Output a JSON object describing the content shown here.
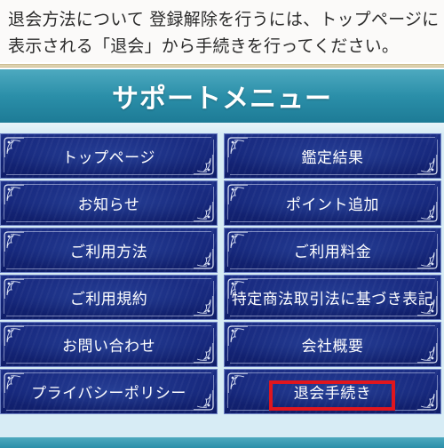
{
  "intro": {
    "line1": "退会方法について 登録解除を行うには、トップページに",
    "line2": "表示される「退会」から手続きを行ってください。"
  },
  "menu": {
    "title": "サポートメニュー",
    "items": [
      {
        "label": "トップページ"
      },
      {
        "label": "鑑定結果"
      },
      {
        "label": "お知らせ"
      },
      {
        "label": "ポイント追加"
      },
      {
        "label": "ご利用方法"
      },
      {
        "label": "ご利用料金"
      },
      {
        "label": "ご利用規約"
      },
      {
        "label": "特定商法取引法に基づき表記"
      },
      {
        "label": "お問い合わせ"
      },
      {
        "label": "会社概要"
      },
      {
        "label": "プライバシーポリシー"
      },
      {
        "label": "退会手続き"
      }
    ]
  },
  "colors": {
    "header": "#2b8fa9",
    "button": "#15267a",
    "highlight": "#e0161e",
    "panel": "#d7ecf5"
  }
}
